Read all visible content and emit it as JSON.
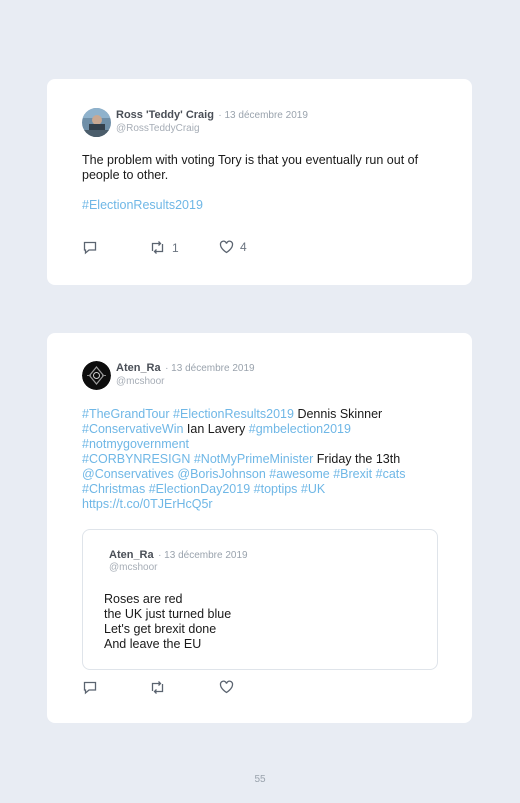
{
  "tweets": [
    {
      "author": "Ross 'Teddy' Craig",
      "date": "· 13 décembre 2019",
      "handle": "@RossTeddyCraig",
      "text": "The problem with voting Tory is that you eventually run out of people to other.",
      "hashtag": "#ElectionResults2019",
      "retweets": "1",
      "likes": "4",
      "avatar_icon": "profile-photo-icon"
    },
    {
      "author": "Aten_Ra",
      "date": "· 13 décembre 2019",
      "handle": "@mcshoor",
      "avatar_icon": "dark-emblem-avatar-icon",
      "lines": [
        [
          {
            "t": "#TheGrandTour",
            "link": true
          },
          {
            "t": " "
          },
          {
            "t": "#ElectionResults2019",
            "link": true
          },
          {
            "t": " Dennis Skinner"
          }
        ],
        [
          {
            "t": "#ConservativeWin",
            "link": true
          },
          {
            "t": " Ian Lavery "
          },
          {
            "t": "#gmbelection2019",
            "link": true
          }
        ],
        [
          {
            "t": "#notmygovernment",
            "link": true
          }
        ],
        [
          {
            "t": "#CORBYNRESIGN",
            "link": true
          },
          {
            "t": " "
          },
          {
            "t": "#NotMyPrimeMinister",
            "link": true
          },
          {
            "t": " Friday the 13th"
          }
        ],
        [
          {
            "t": "@Conservatives",
            "link": true
          },
          {
            "t": " "
          },
          {
            "t": "@BorisJohnson",
            "link": true
          },
          {
            "t": " "
          },
          {
            "t": "#awesome",
            "link": true
          },
          {
            "t": " "
          },
          {
            "t": "#Brexit",
            "link": true
          },
          {
            "t": " "
          },
          {
            "t": "#cats",
            "link": true
          }
        ],
        [
          {
            "t": "#Christmas",
            "link": true
          },
          {
            "t": " "
          },
          {
            "t": "#ElectionDay2019",
            "link": true
          },
          {
            "t": " "
          },
          {
            "t": "#toptips",
            "link": true
          },
          {
            "t": " "
          },
          {
            "t": "#UK",
            "link": true
          }
        ],
        [
          {
            "t": "https://t.co/0TJErHcQ5r",
            "link": true
          }
        ]
      ],
      "quote": {
        "author": "Aten_Ra",
        "date": "· 13 décembre 2019",
        "handle": "@mcshoor",
        "lines": [
          "Roses are red",
          "the UK just turned blue",
          "Let's get brexit done",
          "And leave the EU"
        ]
      }
    }
  ],
  "page_number": "55",
  "colors": {
    "link": "#6fb7e6",
    "background": "#e8ecf3",
    "card": "#ffffff"
  }
}
